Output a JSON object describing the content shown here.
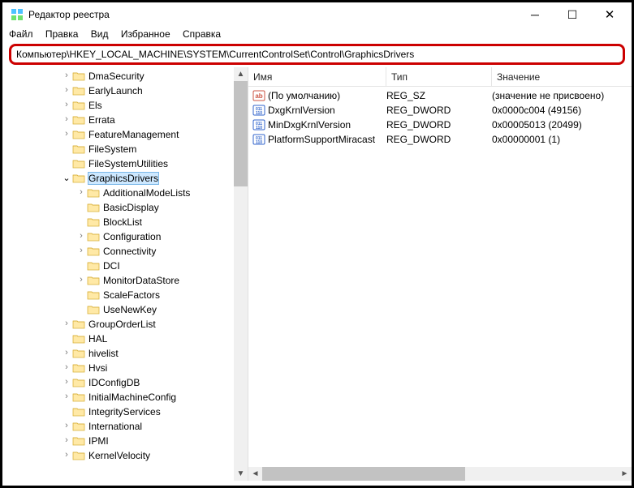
{
  "window": {
    "title": "Редактор реестра"
  },
  "menu": {
    "file": "Файл",
    "edit": "Правка",
    "view": "Вид",
    "favorites": "Избранное",
    "help": "Справка"
  },
  "address": {
    "path": "Компьютер\\HKEY_LOCAL_MACHINE\\SYSTEM\\CurrentControlSet\\Control\\GraphicsDrivers"
  },
  "tree": {
    "items": [
      {
        "depth": 4,
        "twisty": ">",
        "label": "DmaSecurity"
      },
      {
        "depth": 4,
        "twisty": ">",
        "label": "EarlyLaunch"
      },
      {
        "depth": 4,
        "twisty": ">",
        "label": "Els"
      },
      {
        "depth": 4,
        "twisty": ">",
        "label": "Errata"
      },
      {
        "depth": 4,
        "twisty": ">",
        "label": "FeatureManagement"
      },
      {
        "depth": 4,
        "twisty": "",
        "label": "FileSystem"
      },
      {
        "depth": 4,
        "twisty": "",
        "label": "FileSystemUtilities"
      },
      {
        "depth": 4,
        "twisty": "v",
        "label": "GraphicsDrivers",
        "selected": true
      },
      {
        "depth": 5,
        "twisty": ">",
        "label": "AdditionalModeLists"
      },
      {
        "depth": 5,
        "twisty": "",
        "label": "BasicDisplay"
      },
      {
        "depth": 5,
        "twisty": "",
        "label": "BlockList"
      },
      {
        "depth": 5,
        "twisty": ">",
        "label": "Configuration"
      },
      {
        "depth": 5,
        "twisty": ">",
        "label": "Connectivity"
      },
      {
        "depth": 5,
        "twisty": "",
        "label": "DCI"
      },
      {
        "depth": 5,
        "twisty": ">",
        "label": "MonitorDataStore"
      },
      {
        "depth": 5,
        "twisty": "",
        "label": "ScaleFactors"
      },
      {
        "depth": 5,
        "twisty": "",
        "label": "UseNewKey"
      },
      {
        "depth": 4,
        "twisty": ">",
        "label": "GroupOrderList"
      },
      {
        "depth": 4,
        "twisty": "",
        "label": "HAL"
      },
      {
        "depth": 4,
        "twisty": ">",
        "label": "hivelist"
      },
      {
        "depth": 4,
        "twisty": ">",
        "label": "Hvsi"
      },
      {
        "depth": 4,
        "twisty": ">",
        "label": "IDConfigDB"
      },
      {
        "depth": 4,
        "twisty": ">",
        "label": "InitialMachineConfig"
      },
      {
        "depth": 4,
        "twisty": "",
        "label": "IntegrityServices"
      },
      {
        "depth": 4,
        "twisty": ">",
        "label": "International"
      },
      {
        "depth": 4,
        "twisty": ">",
        "label": "IPMI"
      },
      {
        "depth": 4,
        "twisty": ">",
        "label": "KernelVelocity"
      }
    ]
  },
  "values": {
    "headers": {
      "name": "Имя",
      "type": "Тип",
      "value": "Значение"
    },
    "rows": [
      {
        "kind": "sz",
        "name": "(По умолчанию)",
        "type": "REG_SZ",
        "value": "(значение не присвоено)"
      },
      {
        "kind": "dw",
        "name": "DxgKrnlVersion",
        "type": "REG_DWORD",
        "value": "0x0000c004 (49156)"
      },
      {
        "kind": "dw",
        "name": "MinDxgKrnlVersion",
        "type": "REG_DWORD",
        "value": "0x00005013 (20499)"
      },
      {
        "kind": "dw",
        "name": "PlatformSupportMiracast",
        "type": "REG_DWORD",
        "value": "0x00000001 (1)"
      }
    ]
  }
}
